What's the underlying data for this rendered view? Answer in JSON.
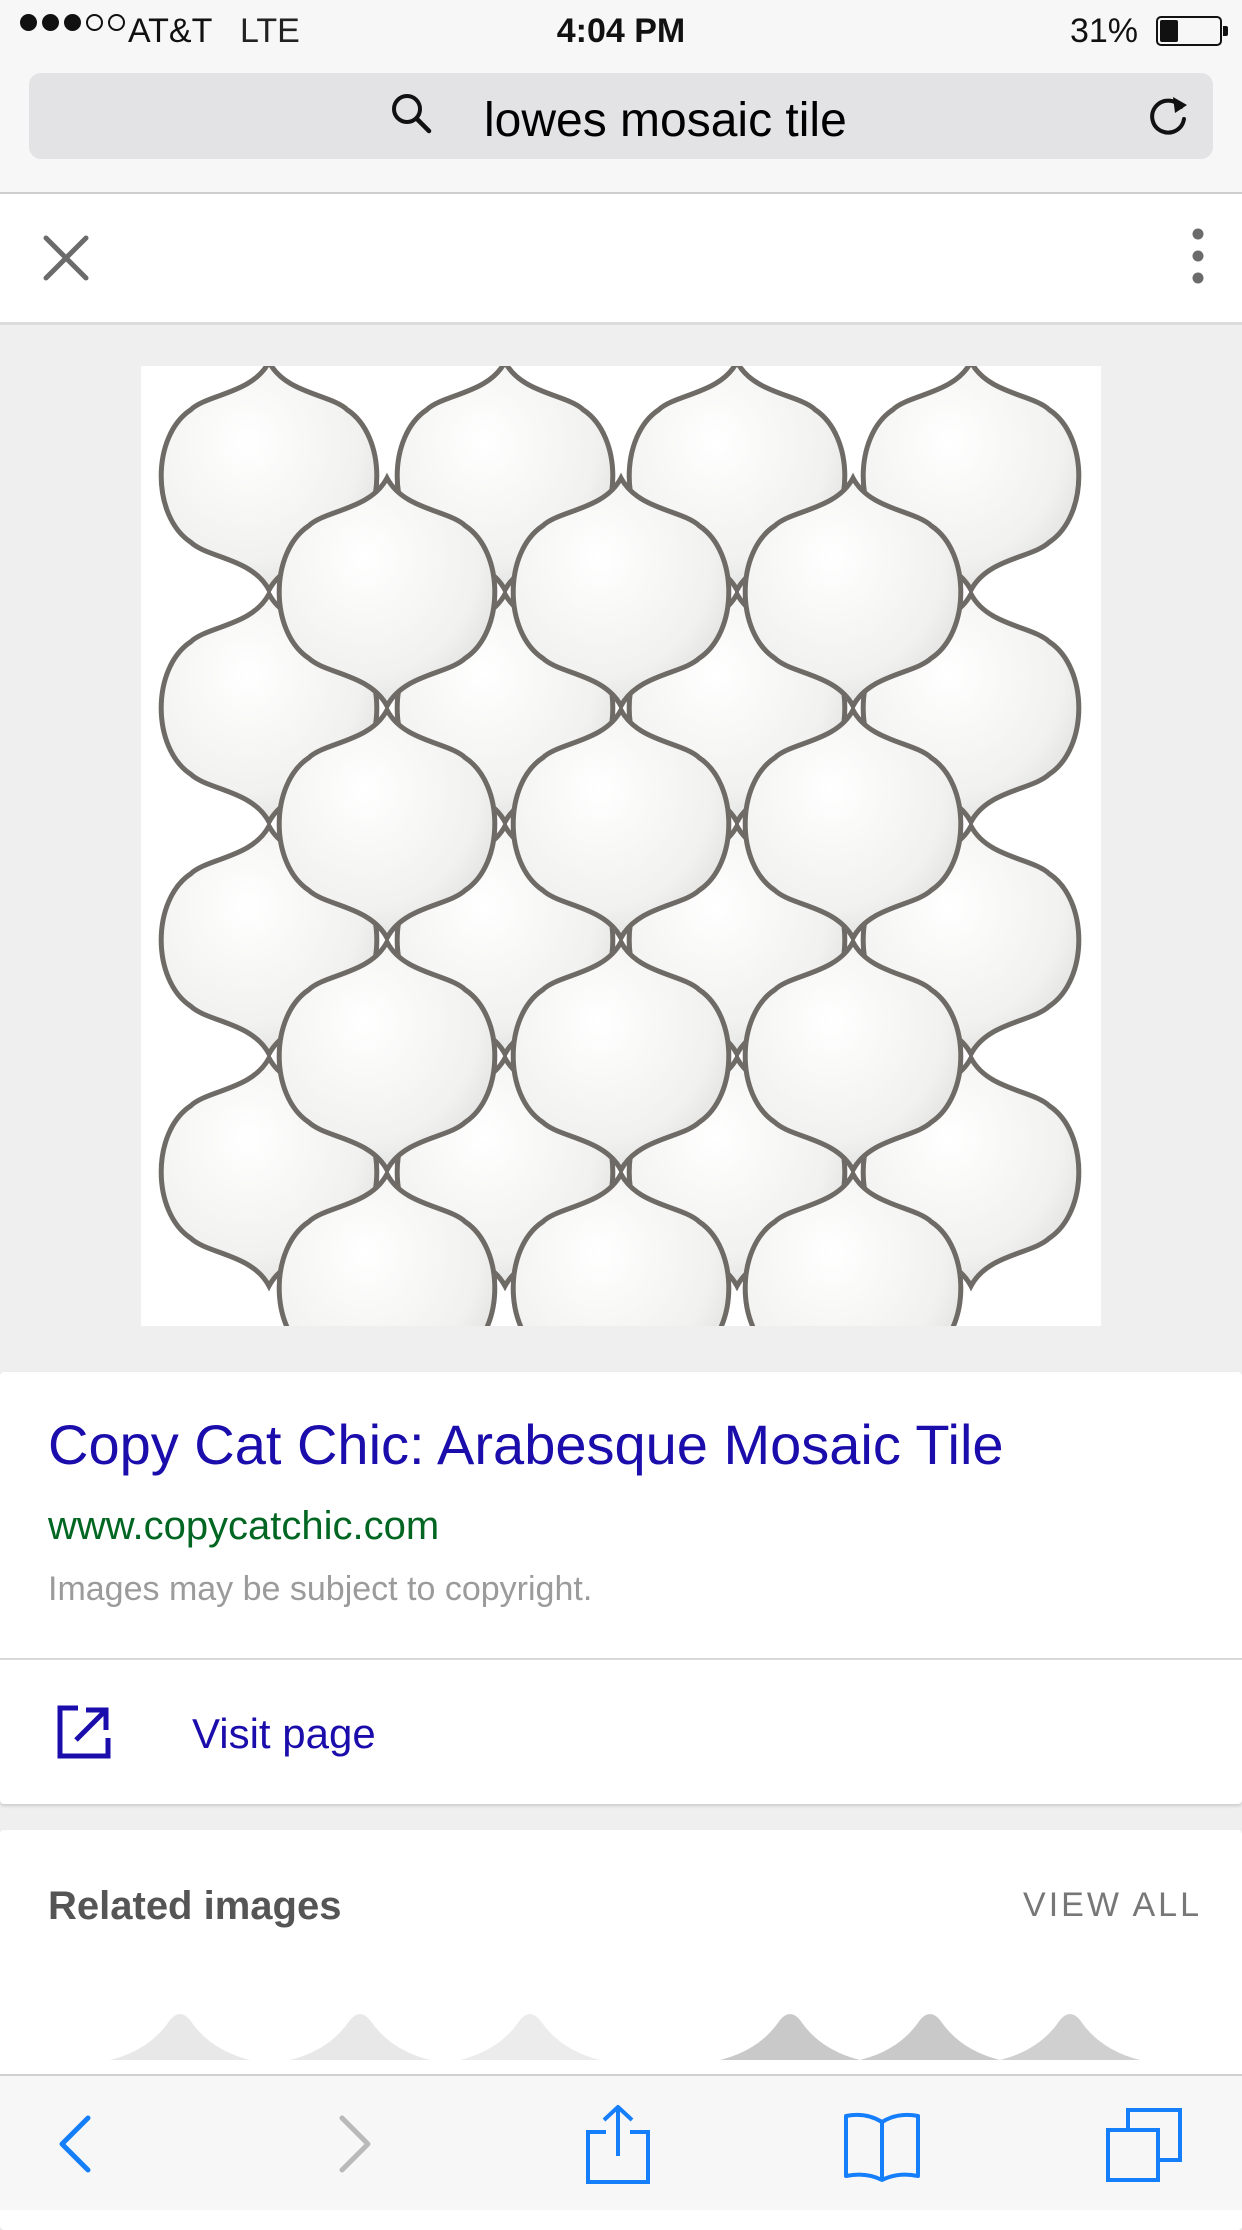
{
  "status_bar": {
    "carrier": "AT&T",
    "network": "LTE",
    "time": "4:04 PM",
    "battery": "31%",
    "battery_level": 0.31,
    "signal_bars_filled": 3,
    "signal_bars_total": 5
  },
  "address_bar": {
    "query": "lowes mosaic tile",
    "search_icon": "search-icon",
    "reload_icon": "reload-icon"
  },
  "viewer": {
    "close_icon": "close-icon",
    "menu_icon": "more-vert-icon",
    "image_subject": "arabesque-lantern-mosaic-tile"
  },
  "result": {
    "title": "Copy Cat Chic: Arabesque Mosaic Tile",
    "url": "www.copycatchic.com",
    "notice": "Images may be subject to copyright.",
    "visit_label": "Visit page",
    "visit_icon": "external-link-icon"
  },
  "related": {
    "heading": "Related images",
    "view_all": "VIEW ALL"
  },
  "toolbar": {
    "icons": [
      "back-icon",
      "forward-icon",
      "share-icon",
      "bookmarks-icon",
      "tabs-icon"
    ]
  },
  "colors": {
    "link": "#1a0dab",
    "url_green": "#006621",
    "ios_blue": "#157efb",
    "grout": "#6e6a66"
  }
}
